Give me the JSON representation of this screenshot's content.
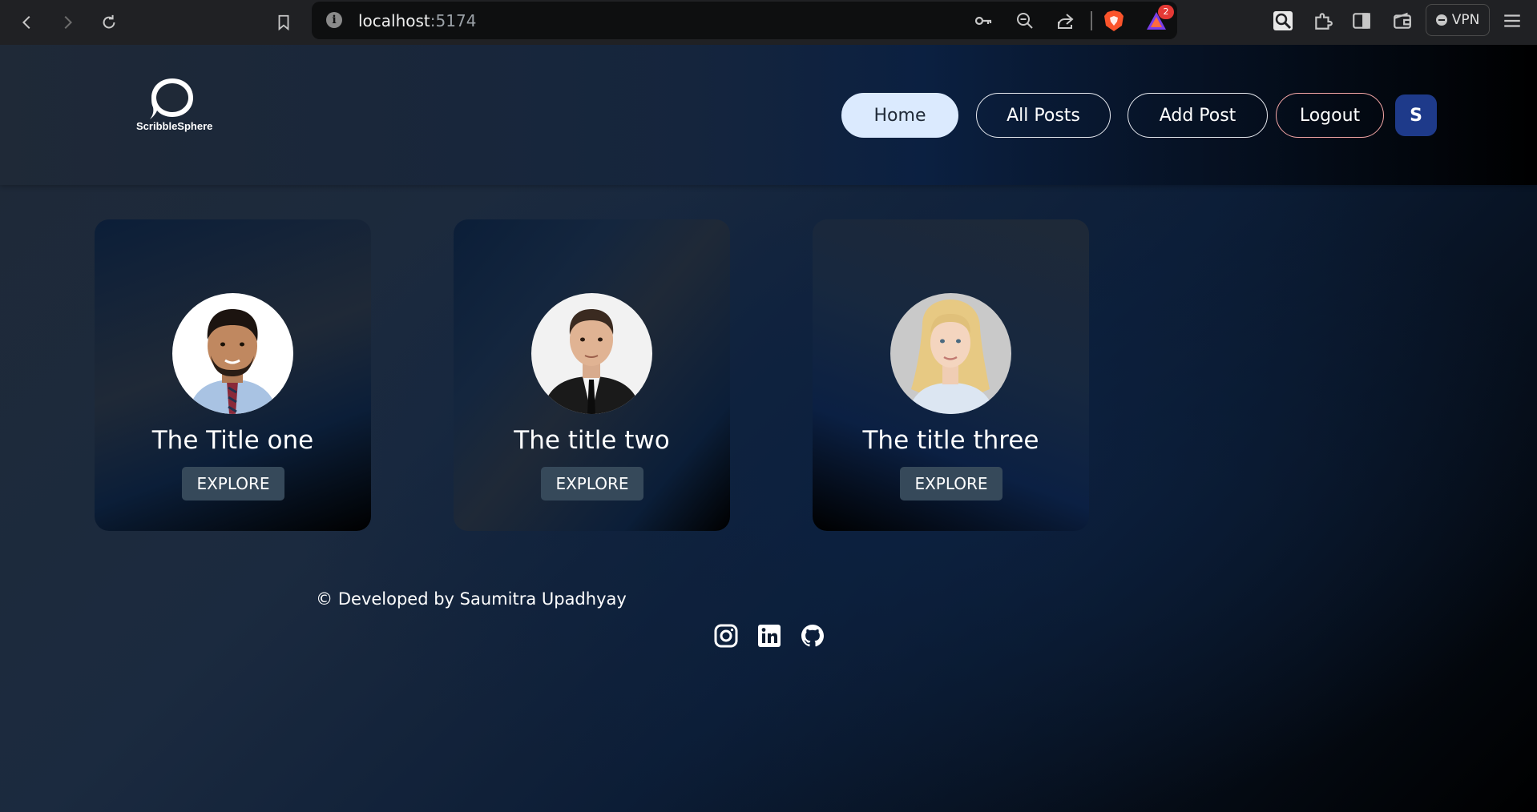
{
  "browser": {
    "url_host": "localhost",
    "url_port": ":5174",
    "rewards_badge": "2",
    "vpn_label": "VPN"
  },
  "header": {
    "logo_text": "ScribbleSphere",
    "nav": {
      "home": "Home",
      "all_posts": "All Posts",
      "add_post": "Add Post",
      "logout": "Logout"
    },
    "user_initial": "S"
  },
  "posts": [
    {
      "title": "The Title one",
      "button": "EXPLORE"
    },
    {
      "title": "The title two",
      "button": "EXPLORE"
    },
    {
      "title": "The title three",
      "button": "EXPLORE"
    }
  ],
  "footer": {
    "credit": "© Developed by Saumitra Upadhyay",
    "socials": [
      "instagram-icon",
      "linkedin-icon",
      "github-icon"
    ]
  },
  "colors": {
    "active_nav": "#dbeafe",
    "avatar_bg": "#1e3a8a",
    "explore_bg": "#36495a",
    "logout_border": "#f4a6a6"
  }
}
